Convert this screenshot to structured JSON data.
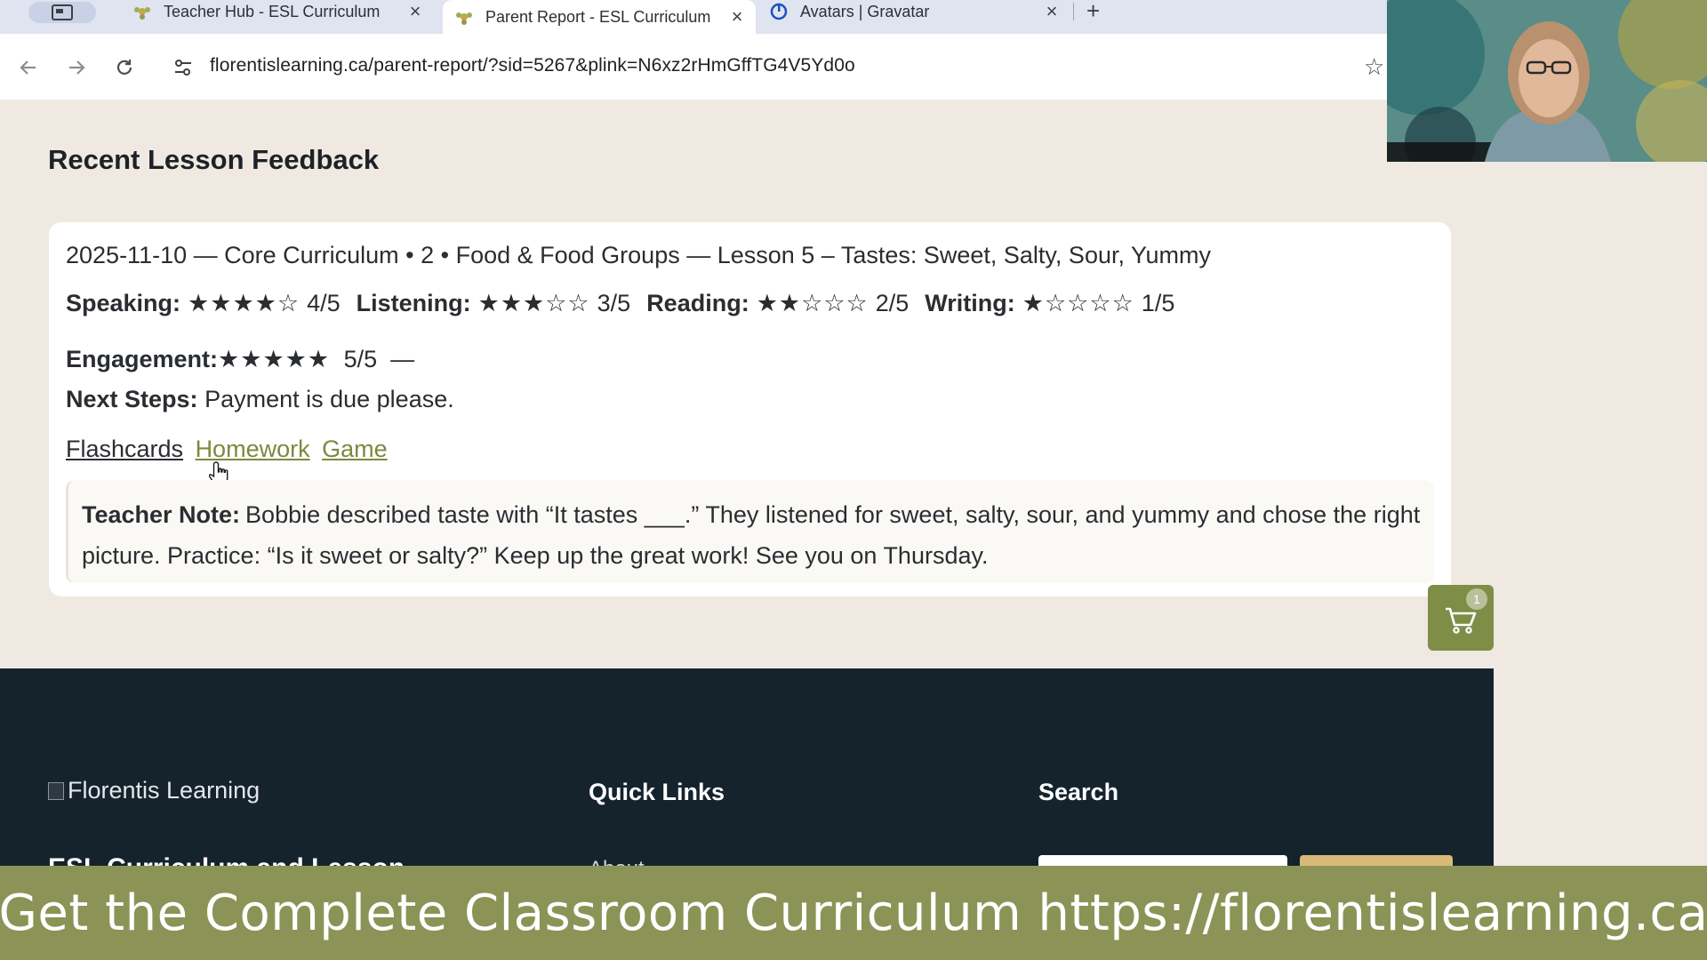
{
  "browser": {
    "tabs": [
      {
        "title": "Teacher Hub - ESL Curriculum",
        "active": false
      },
      {
        "title": "Parent Report - ESL Curriculum",
        "active": true
      },
      {
        "title": "Avatars | Gravatar",
        "active": false
      }
    ],
    "new_tab_label": "+",
    "url": "florentislearning.ca/parent-report/?sid=5267&plink=N6xz2rHmGffTG4V5Yd0o"
  },
  "report": {
    "heading": "Recent Lesson Feedback",
    "lesson_line": "2025-11-10 — Core Curriculum • 2 • Food & Food Groups — Lesson 5 – Tastes: Sweet, Salty, Sour, Yummy",
    "ratings": [
      {
        "label": "Speaking:",
        "stars": "★★★★☆",
        "score": "4/5",
        "value": 4,
        "max": 5
      },
      {
        "label": "Listening:",
        "stars": "★★★☆☆",
        "score": "3/5",
        "value": 3,
        "max": 5
      },
      {
        "label": "Reading:",
        "stars": "★★☆☆☆",
        "score": "2/5",
        "value": 2,
        "max": 5
      },
      {
        "label": "Writing:",
        "stars": "★☆☆☆☆",
        "score": "1/5",
        "value": 1,
        "max": 5
      }
    ],
    "engagement": {
      "label": "Engagement:",
      "stars": "★★★★★",
      "score": "5/5",
      "value": 5,
      "max": 5,
      "suffix": "—"
    },
    "next_steps": {
      "label": "Next Steps:",
      "text": "Payment is due please."
    },
    "links": {
      "flashcards": "Flashcards",
      "homework": "Homework",
      "game": "Game"
    },
    "teacher_note": {
      "label": "Teacher Note:",
      "text": "Bobbie described taste with “It tastes ___.” They listened for sweet, salty, sour, and yummy and chose the right picture. Practice: “Is it sweet or salty?” Keep up the great work! See you on Thursday."
    }
  },
  "cart": {
    "count": "1"
  },
  "footer": {
    "logo_alt": "Florentis Learning",
    "subtitle": "ESL Curriculum and Lesson",
    "quick_links_heading": "Quick Links",
    "quick_link_first": "About",
    "search_heading": "Search"
  },
  "banner": {
    "text": "Get the Complete Classroom Curriculum https://florentislearning.ca"
  },
  "colors": {
    "page_bg": "#efe9e1",
    "footer_bg": "#15232d",
    "accent_olive": "#7f8e47",
    "banner_bg": "#8b9456",
    "search_button": "#d8b978"
  }
}
